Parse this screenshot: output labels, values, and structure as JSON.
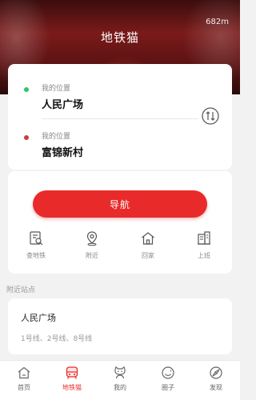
{
  "header": {
    "title": "地铁猫",
    "distance": "682m"
  },
  "origin": {
    "label": "我的位置",
    "value": "人民广场",
    "dot_color": "#2ec36b"
  },
  "destination": {
    "label": "我的位置",
    "value": "富锦新村",
    "dot_color": "#d43a3a"
  },
  "swap_icon": "swap-route-icon",
  "navigate_button": {
    "label": "导航",
    "color": "#e82a2a"
  },
  "quick_actions": [
    {
      "label": "查地铁",
      "icon": "search-document-icon"
    },
    {
      "label": "附近",
      "icon": "location-pin-icon"
    },
    {
      "label": "回家",
      "icon": "home-icon"
    },
    {
      "label": "上班",
      "icon": "building-icon"
    }
  ],
  "nearby": {
    "section_label": "附近站点",
    "station_name": "人民广场",
    "lines": "1号线、2号线、8号线"
  },
  "tabbar": {
    "active_color": "#e82a2a",
    "items": [
      {
        "label": "首页",
        "icon": "home-icon"
      },
      {
        "label": "地铁猫",
        "icon": "subway-train-icon"
      },
      {
        "label": "我的",
        "icon": "cat-icon"
      },
      {
        "label": "圈子",
        "icon": "smile-icon"
      },
      {
        "label": "发现",
        "icon": "compass-icon"
      }
    ]
  }
}
